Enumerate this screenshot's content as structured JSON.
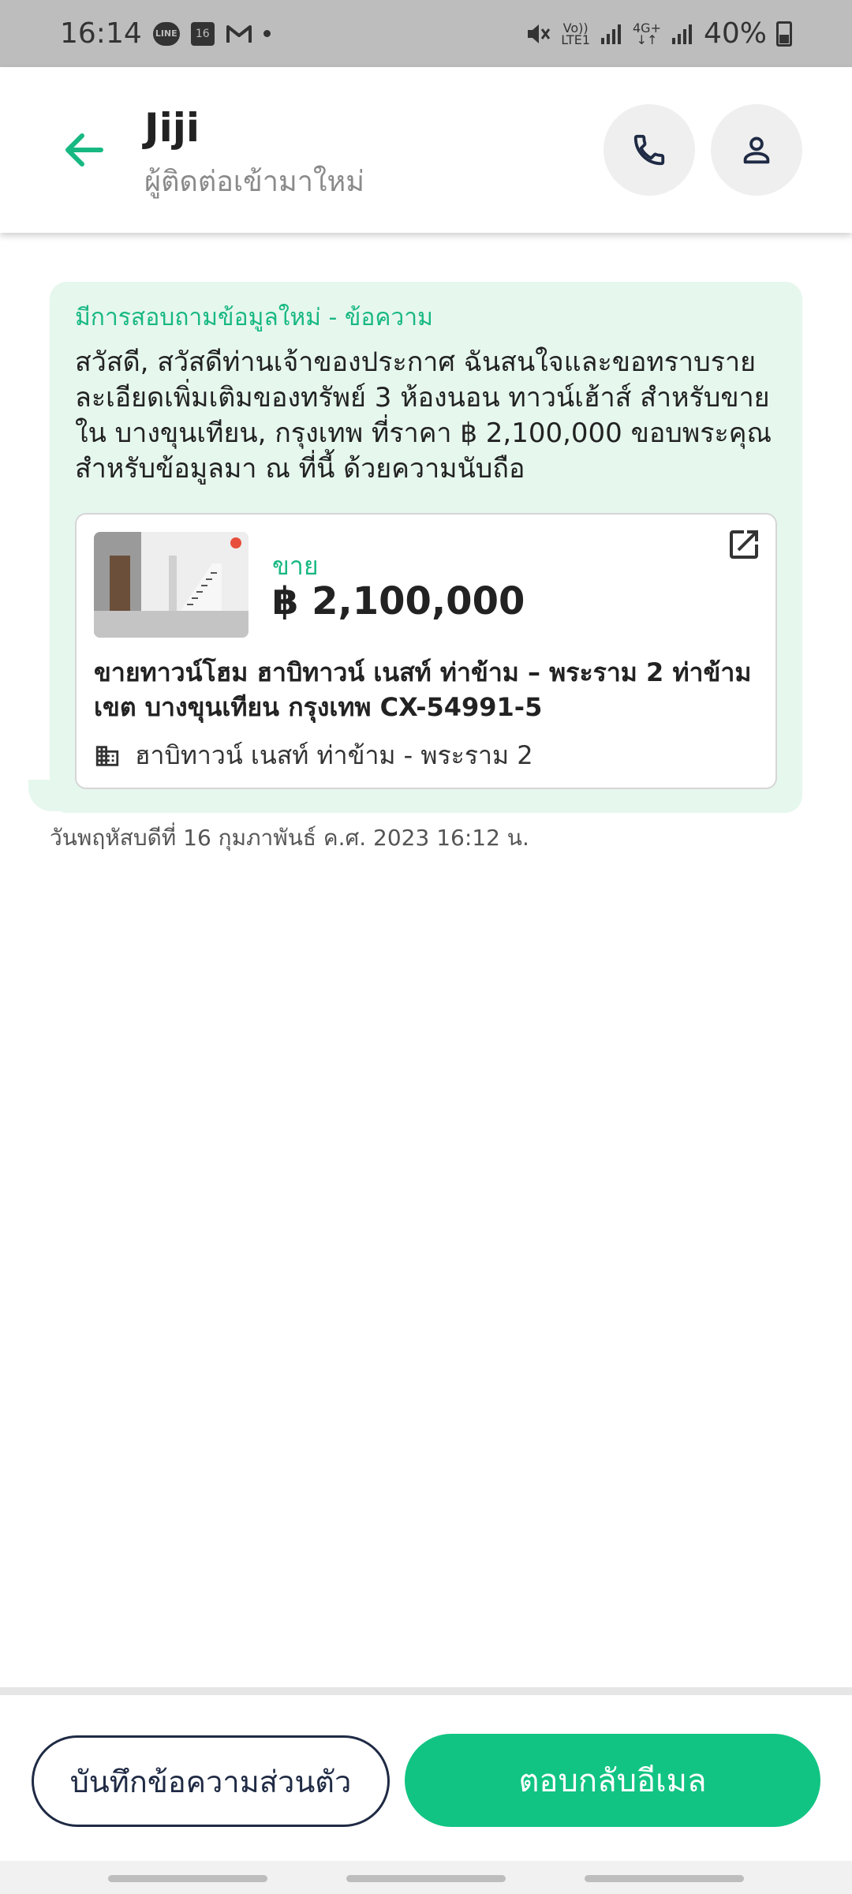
{
  "status_bar": {
    "time": "16:14",
    "line_badge": "LINE",
    "calendar_day": "16",
    "volte_top": "Vo))",
    "volte_bottom": "LTE1",
    "network_top": "4G+",
    "network_bottom": "↓↑",
    "battery": "40%"
  },
  "header": {
    "name": "Jiji",
    "subtitle": "ผู้ติดต่อเข้ามาใหม่",
    "icons": {
      "back": "arrow-left-icon",
      "call": "phone-icon",
      "profile": "person-icon"
    },
    "accent_color": "#17b882"
  },
  "message": {
    "title": "มีการสอบถามข้อมูลใหม่ - ข้อความ",
    "body": "สวัสดี, สวัสดีท่านเจ้าของประกาศ ฉันสนใจและขอทราบรายละเอียดเพิ่มเติมของทรัพย์ 3 ห้องนอน ทาวน์เฮ้าส์ สำหรับขายใน บางขุนเทียน, กรุงเทพ ที่ราคา ฿ 2,100,000 ขอบพระคุณสำหรับข้อมูลมา ณ ที่นี้ ด้วยความนับถือ",
    "bubble_color": "#e6f7ee",
    "listing": {
      "type": "ขาย",
      "price": "฿ 2,100,000",
      "title": "ขายทาวน์โฮม  ฮาบิทาวน์ เนสท์ ท่าข้าม – พระราม 2 ท่าข้าม เขต บางขุนเทียน กรุงเทพ CX-54991-5",
      "project": "ฮาบิทาวน์ เนสท์ ท่าข้าม - พระราม 2"
    },
    "timestamp": "วันพฤหัสบดีที่ 16 กุมภาพันธ์ ค.ศ. 2023 16:12 น."
  },
  "actions": {
    "note_label": "บันทึกข้อความส่วนตัว",
    "reply_label": "ตอบกลับอีเมล",
    "reply_color": "#12c483"
  }
}
